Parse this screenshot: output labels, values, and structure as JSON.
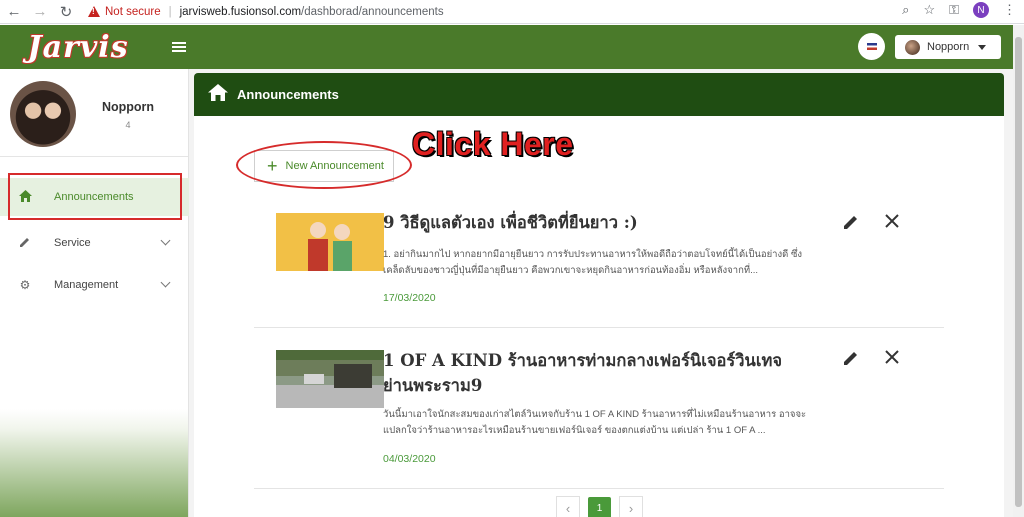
{
  "browser": {
    "not_secure": "Not secure",
    "url_host": "jarvisweb.fusionsol.com",
    "url_path": "/dashborad/announcements",
    "profile_initial": "N"
  },
  "header": {
    "logo": "Jarvis",
    "user_name": "Nopporn"
  },
  "sidebar": {
    "profile_name": "Nopporn",
    "profile_sub": "4",
    "items": [
      {
        "label": "Announcements",
        "icon": "home-icon",
        "active": true
      },
      {
        "label": "Service",
        "icon": "pencil-icon",
        "active": false
      },
      {
        "label": "Management",
        "icon": "gear-icon",
        "active": false
      }
    ]
  },
  "page": {
    "title": "Announcements",
    "new_button": "New Announcement",
    "callout": "Click Here"
  },
  "announcements": [
    {
      "title": "9 วิธีดูแลตัวเอง เพื่อชีวิตที่ยืนยาว :)",
      "description": "1. อย่ากินมากไป หากอยากมีอายุยืนยาว การรับประทานอาหารให้พอดีถือว่าตอบโจทย์นี้ได้เป็นอย่างดี ซึ่งเคล็ดลับของชาวญี่ปุ่นที่มีอายุยืนยาว คือพวกเขาจะหยุดกินอาหารก่อนท้องอิ่ม หรือหลังจากที่...",
      "date": "17/03/2020"
    },
    {
      "title": "1 OF A KIND ร้านอาหารท่ามกลางเฟอร์นิเจอร์วินเทจ ย่านพระราม9",
      "description": "วันนี้มาเอาใจนักสะสมของเก่าสไตล์วินเทจกับร้าน 1 OF A KIND ร้านอาหารที่ไม่เหมือนร้านอาหาร อาจจะแปลกใจว่าร้านอาหารอะไรเหมือนร้านขายเฟอร์นิเจอร์ ของตกแต่งบ้าน แต่เปล่า ร้าน 1 OF A ...",
      "date": "04/03/2020"
    }
  ],
  "pagination": {
    "prev": "‹",
    "current": "1",
    "next": "›"
  },
  "colors": {
    "appbar": "#4a7a2a",
    "page_header": "#1f4d12",
    "accent_green": "#4a9a3a",
    "highlight_red": "#d62b2b"
  }
}
